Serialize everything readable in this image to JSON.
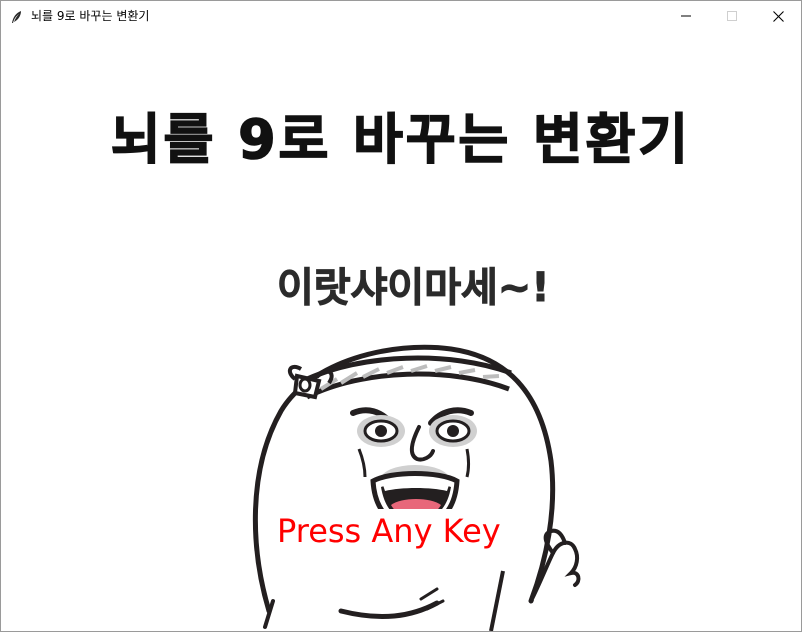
{
  "window": {
    "title": "뇌를 9로 바꾸는 변환기",
    "icon": "feather-icon",
    "controls": [
      "minimize-icon",
      "maximize-icon",
      "close-icon"
    ]
  },
  "main": {
    "heading": "뇌를 9로 바꾸는 변환기",
    "greeting": "이랏샤이마세~!",
    "prompt": "Press Any Key"
  },
  "colors": {
    "prompt": "#ff0000",
    "heading": "#111111",
    "background": "#ffffff"
  }
}
